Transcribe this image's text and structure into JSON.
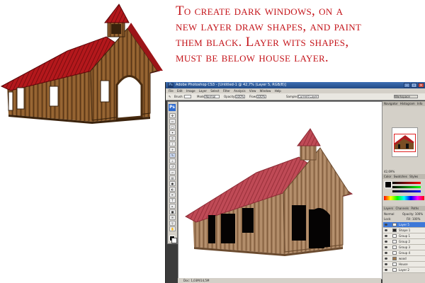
{
  "caption": {
    "lines": [
      "To create dark windows, on a",
      "new layer draw shapes, and paint",
      "them black. Layer wits shapes,",
      "must be below house layer."
    ]
  },
  "photoshop": {
    "title": "Adobe Photoshop CS3 - [Untitled-1 @ 42,7% (Layer 5, RGB/8)]",
    "menu": [
      "File",
      "Edit",
      "Image",
      "Layer",
      "Select",
      "Filter",
      "Analysis",
      "View",
      "Window",
      "Help"
    ],
    "options": {
      "brush_label": "Brush:",
      "mode_label": "Mode:",
      "mode_value": "Normal",
      "opacity_label": "Opacity:",
      "opacity_value": "100%",
      "flow_label": "Flow:",
      "flow_value": "100%",
      "sample_label": "Sample:",
      "sample_value": "Current Layer",
      "workspace_label": "Workspace"
    },
    "status": "Doc: 1,03M/14,5M",
    "panels": {
      "navigator_tabs": [
        "Navigator",
        "Histogram",
        "Info"
      ],
      "zoom": "42,69%",
      "color_tabs": [
        "Color",
        "Swatches",
        "Styles"
      ],
      "layers_tabs": [
        "Layers",
        "Channels",
        "Paths"
      ],
      "blend": "Normal",
      "opacity": "Opacity: 100%",
      "fill": "Fill: 100%",
      "lock_label": "Lock:",
      "layers": [
        {
          "name": "Layer 5",
          "selected": true
        },
        {
          "name": "Shape 1",
          "selected": false
        },
        {
          "name": "Group 1",
          "selected": false
        },
        {
          "name": "Group 2",
          "selected": false
        },
        {
          "name": "Group 3",
          "selected": false
        },
        {
          "name": "Group 4",
          "selected": false
        },
        {
          "name": "wood",
          "selected": false
        },
        {
          "name": "House",
          "selected": false
        },
        {
          "name": "Layer 2",
          "selected": false
        }
      ]
    }
  },
  "colors": {
    "caption": "#c4141a",
    "roof": "#b01a1e",
    "wood": "#7a4e24",
    "selection": "#3d78d8"
  },
  "icons": [
    "photoshop-icon",
    "move-tool-icon",
    "marquee-tool-icon",
    "lasso-tool-icon",
    "brush-tool-icon",
    "eye-icon"
  ]
}
